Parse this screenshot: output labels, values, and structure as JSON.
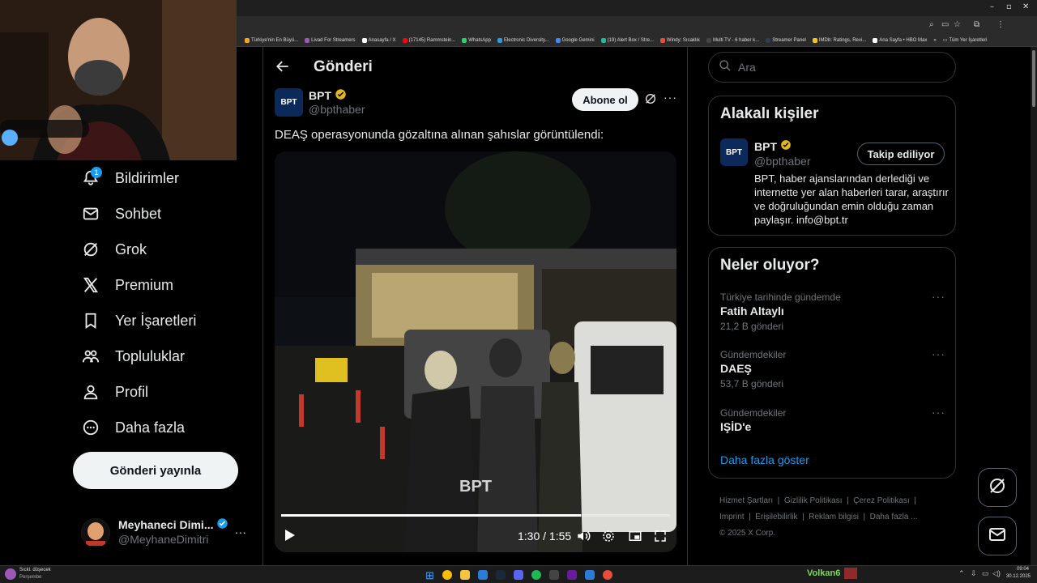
{
  "browser": {
    "bookmarks": [
      {
        "label": "Türkiye'nin En Büyü...",
        "color": "#f5a623"
      },
      {
        "label": "Livad For Streamers",
        "color": "#9b59b6"
      },
      {
        "label": "Anasayfa / X",
        "color": "#ffffff"
      },
      {
        "label": "(17145) Rammstein...",
        "color": "#ff0000"
      },
      {
        "label": "WhatsApp",
        "color": "#25d366"
      },
      {
        "label": "Electronic Diversity...",
        "color": "#3498db"
      },
      {
        "label": "Google Gemini",
        "color": "#4285f4"
      },
      {
        "label": "(19) Alert Box / Stre...",
        "color": "#1abc9c"
      },
      {
        "label": "Windy: Sıcaklık",
        "color": "#e74c3c"
      },
      {
        "label": "Multi TV - 6 haber k...",
        "color": "#444444"
      },
      {
        "label": "Streamer Panel",
        "color": "#2c3e50"
      },
      {
        "label": "IMDb: Ratings, Revi...",
        "color": "#f5c518"
      },
      {
        "label": "Ana Sayfa • HBO Max",
        "color": "#ffffff"
      }
    ],
    "all_bookmarks": "Tüm Yer İşaretleri"
  },
  "nav": {
    "items": [
      {
        "label": "Bildirimler",
        "icon": "bell-icon",
        "badge": "1"
      },
      {
        "label": "Sohbet",
        "icon": "mail-icon"
      },
      {
        "label": "Grok",
        "icon": "grok-icon"
      },
      {
        "label": "Premium",
        "icon": "x-logo-icon"
      },
      {
        "label": "Yer İşaretleri",
        "icon": "bookmark-icon"
      },
      {
        "label": "Topluluklar",
        "icon": "people-icon"
      },
      {
        "label": "Profil",
        "icon": "person-icon"
      },
      {
        "label": "Daha fazla",
        "icon": "more-circle-icon"
      }
    ],
    "post_button": "Gönderi yayınla",
    "account": {
      "name": "Meyhaneci Dimi...",
      "handle": "@MeyhaneDimitri",
      "more": "..."
    }
  },
  "post": {
    "header_title": "Gönderi",
    "author_name": "BPT",
    "author_handle": "@bpthaber",
    "subscribe_label": "Abone ol",
    "text": "DEAŞ operasyonunda gözaltına alınan şahıslar görüntülendi:",
    "video": {
      "time": "1:30 / 1:55",
      "progress": 0.77,
      "watermark": "BPT"
    }
  },
  "right": {
    "search_placeholder": "Ara",
    "related_title": "Alakalı kişiler",
    "related": {
      "name": "BPT",
      "handle": "@bpthaber",
      "follow_label": "Takip ediliyor",
      "bio": "BPT, haber ajanslarından derlediği ve internette yer alan haberleri tarar, araştırır ve doğruluğundan emin olduğu zaman paylaşır. info@bpt.tr"
    },
    "trends_title": "Neler oluyor?",
    "trends": [
      {
        "context": "Türkiye tarihinde gündemde",
        "name": "Fatih Altaylı",
        "count": "21,2 B gönderi"
      },
      {
        "context": "Gündemdekiler",
        "name": "DAEŞ",
        "count": "53,7 B gönderi"
      },
      {
        "context": "Gündemdekiler",
        "name": "IŞİD'e",
        "count": ""
      }
    ],
    "show_more": "Daha fazla göster",
    "footer_links": [
      "Hizmet Şartları",
      "Gizlilik Politikası",
      "Çerez Politikası",
      "Imprint",
      "Erişilebilirlik",
      "Reklam bilgisi",
      "Daha fazla ..."
    ],
    "copyright": "© 2025 X Corp."
  },
  "taskbar": {
    "weather_temp": "Sıckl. düşecek",
    "weather_day": "Perşembe",
    "streamer": "Volkan6",
    "time": "09:04",
    "date": "30.12.2025"
  }
}
